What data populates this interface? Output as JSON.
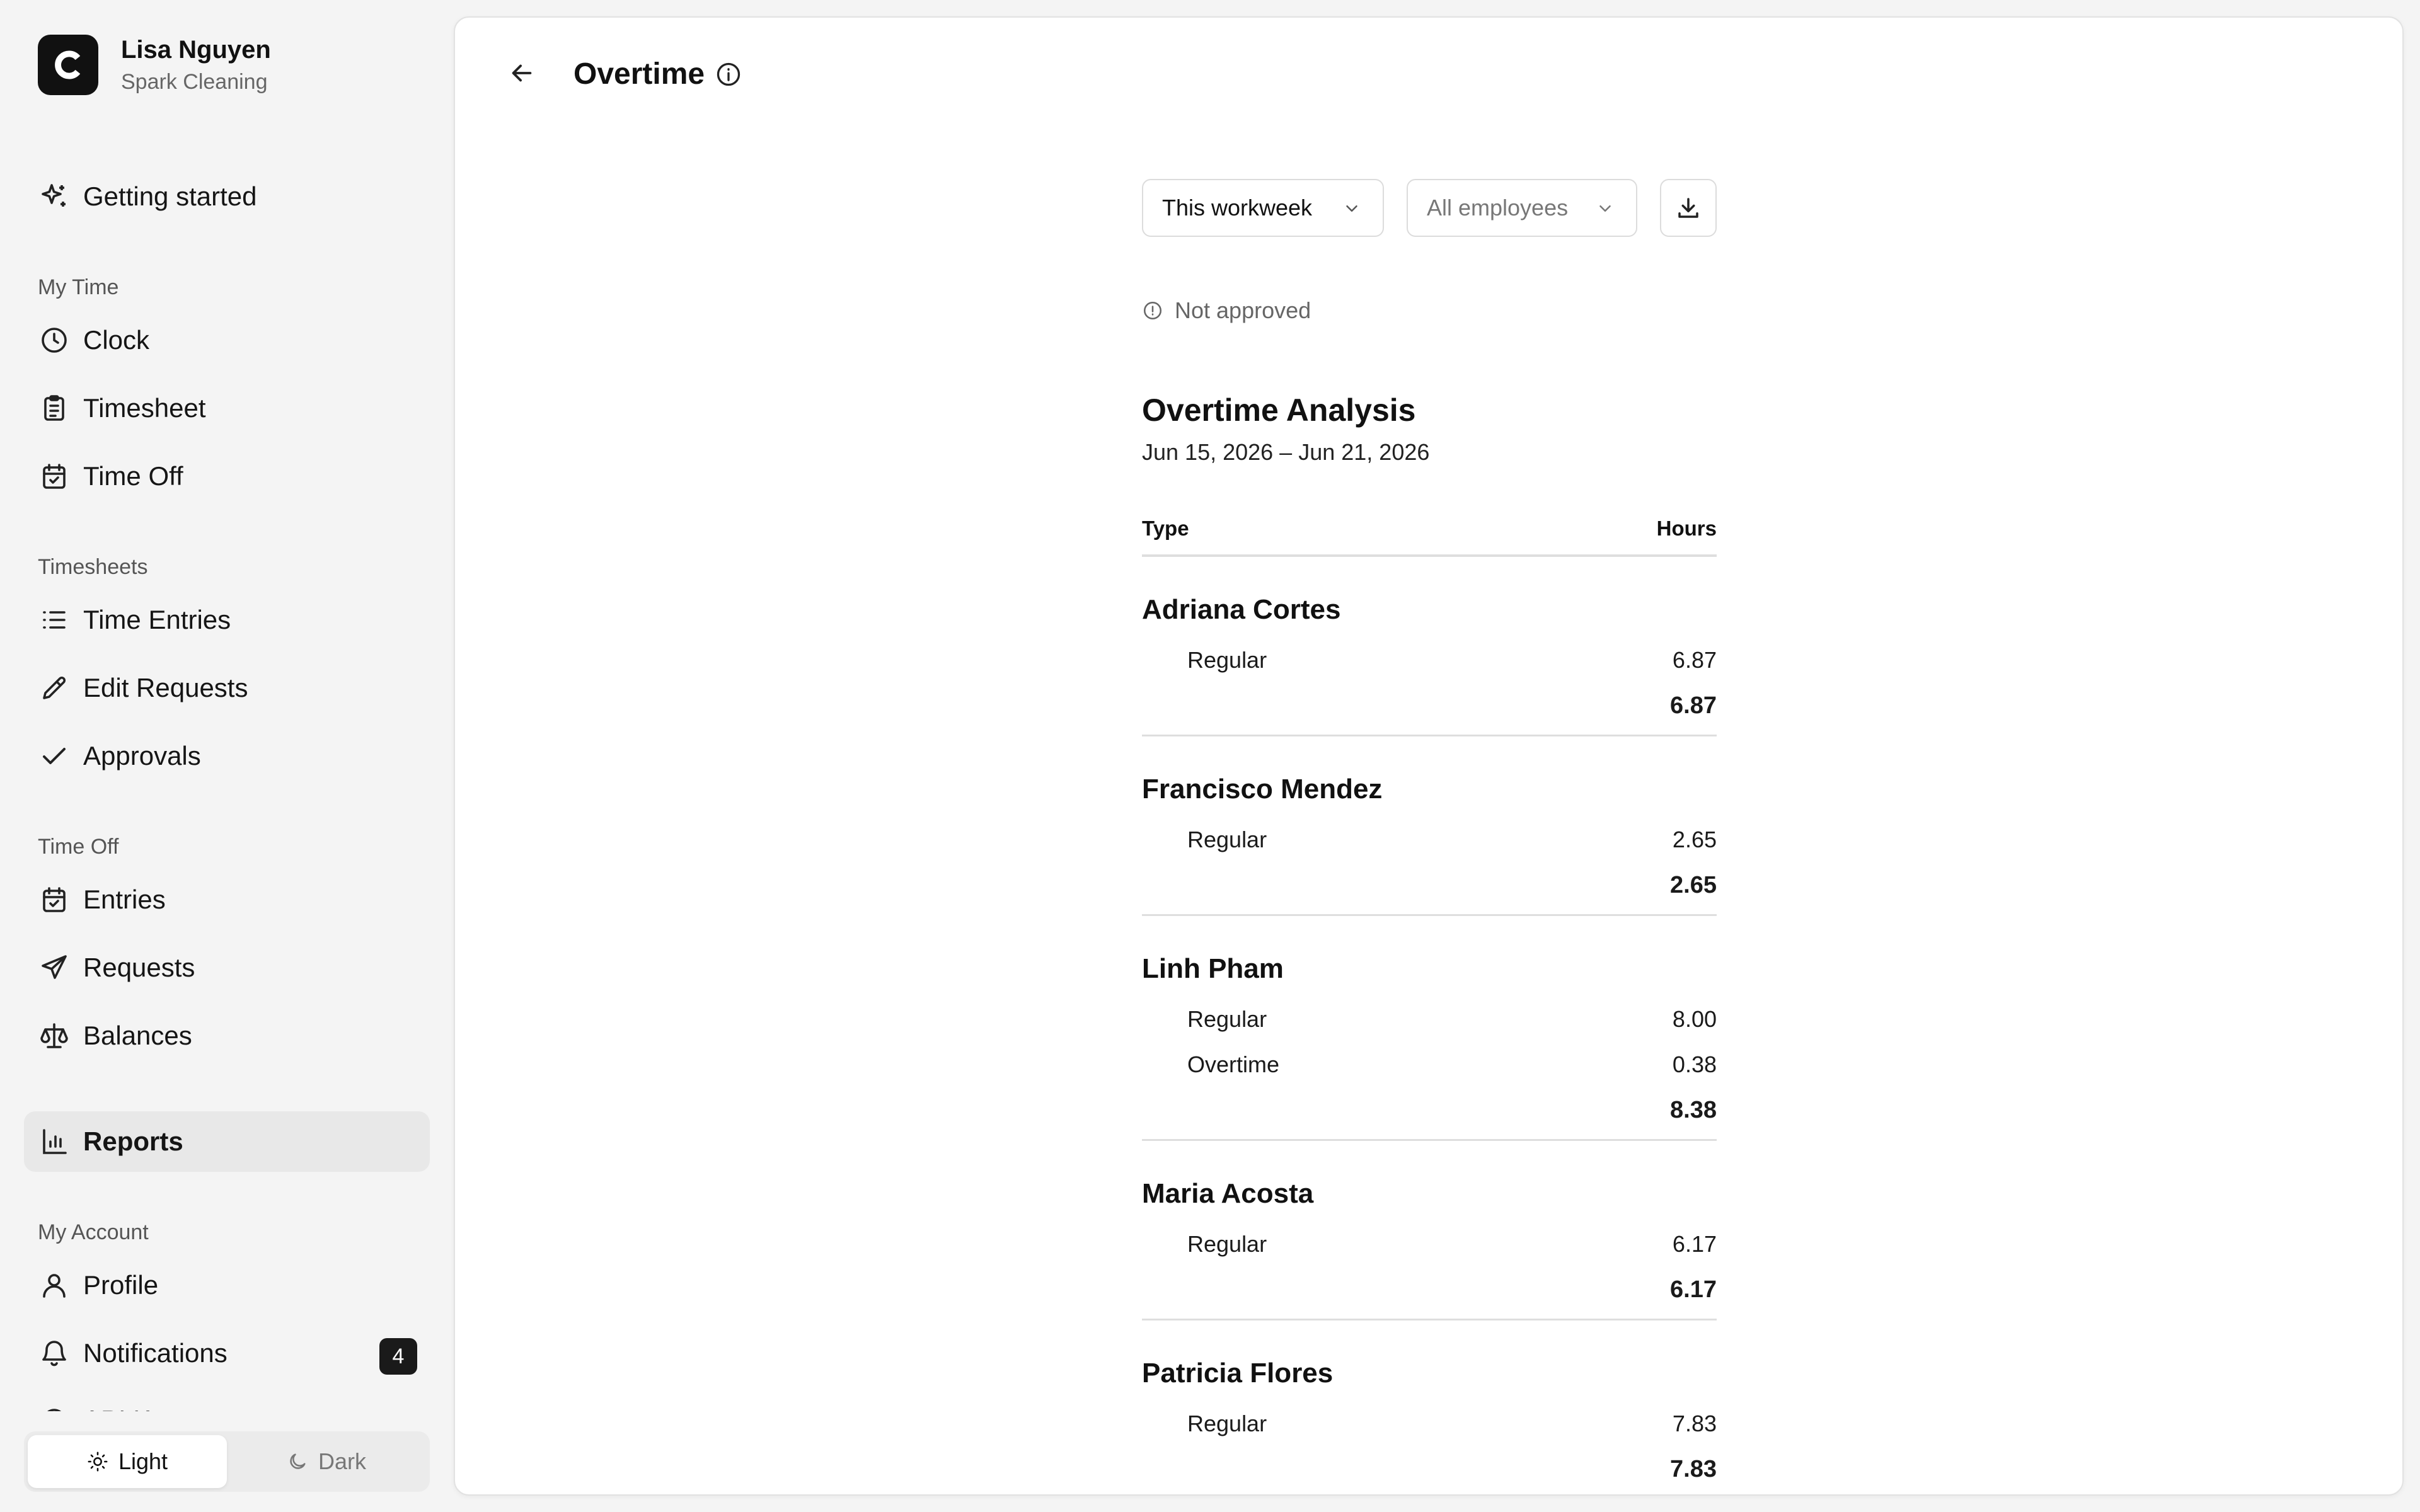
{
  "user": {
    "name": "Lisa Nguyen",
    "org": "Spark Cleaning",
    "logo_letter": "C"
  },
  "nav": {
    "getting_started": "Getting started",
    "my_time": {
      "label": "My Time",
      "clock": "Clock",
      "timesheet": "Timesheet",
      "time_off": "Time Off"
    },
    "timesheets": {
      "label": "Timesheets",
      "entries": "Time Entries",
      "edit_requests": "Edit Requests",
      "approvals": "Approvals"
    },
    "time_off": {
      "label": "Time Off",
      "entries": "Entries",
      "requests": "Requests",
      "balances": "Balances"
    },
    "reports": "Reports",
    "my_account": {
      "label": "My Account",
      "profile": "Profile",
      "notifications": "Notifications",
      "notifications_count": "4",
      "next_cut": "API Keys"
    }
  },
  "theme": {
    "light": "Light",
    "dark": "Dark"
  },
  "page": {
    "title": "Overtime"
  },
  "filters": {
    "period": "This workweek",
    "employees": "All employees"
  },
  "status": "Not approved",
  "report": {
    "title": "Overtime Analysis",
    "range": "Jun 15, 2026 – Jun 21, 2026",
    "col_type": "Type",
    "col_hours": "Hours",
    "groups": [
      {
        "name": "Adriana Cortes",
        "rows": [
          {
            "type": "Regular",
            "hours": "6.87"
          }
        ],
        "total": "6.87"
      },
      {
        "name": "Francisco Mendez",
        "rows": [
          {
            "type": "Regular",
            "hours": "2.65"
          }
        ],
        "total": "2.65"
      },
      {
        "name": "Linh Pham",
        "rows": [
          {
            "type": "Regular",
            "hours": "8.00"
          },
          {
            "type": "Overtime",
            "hours": "0.38"
          }
        ],
        "total": "8.38"
      },
      {
        "name": "Maria Acosta",
        "rows": [
          {
            "type": "Regular",
            "hours": "6.17"
          }
        ],
        "total": "6.17"
      },
      {
        "name": "Patricia Flores",
        "rows": [
          {
            "type": "Regular",
            "hours": "7.83"
          }
        ],
        "total": "7.83"
      }
    ]
  }
}
